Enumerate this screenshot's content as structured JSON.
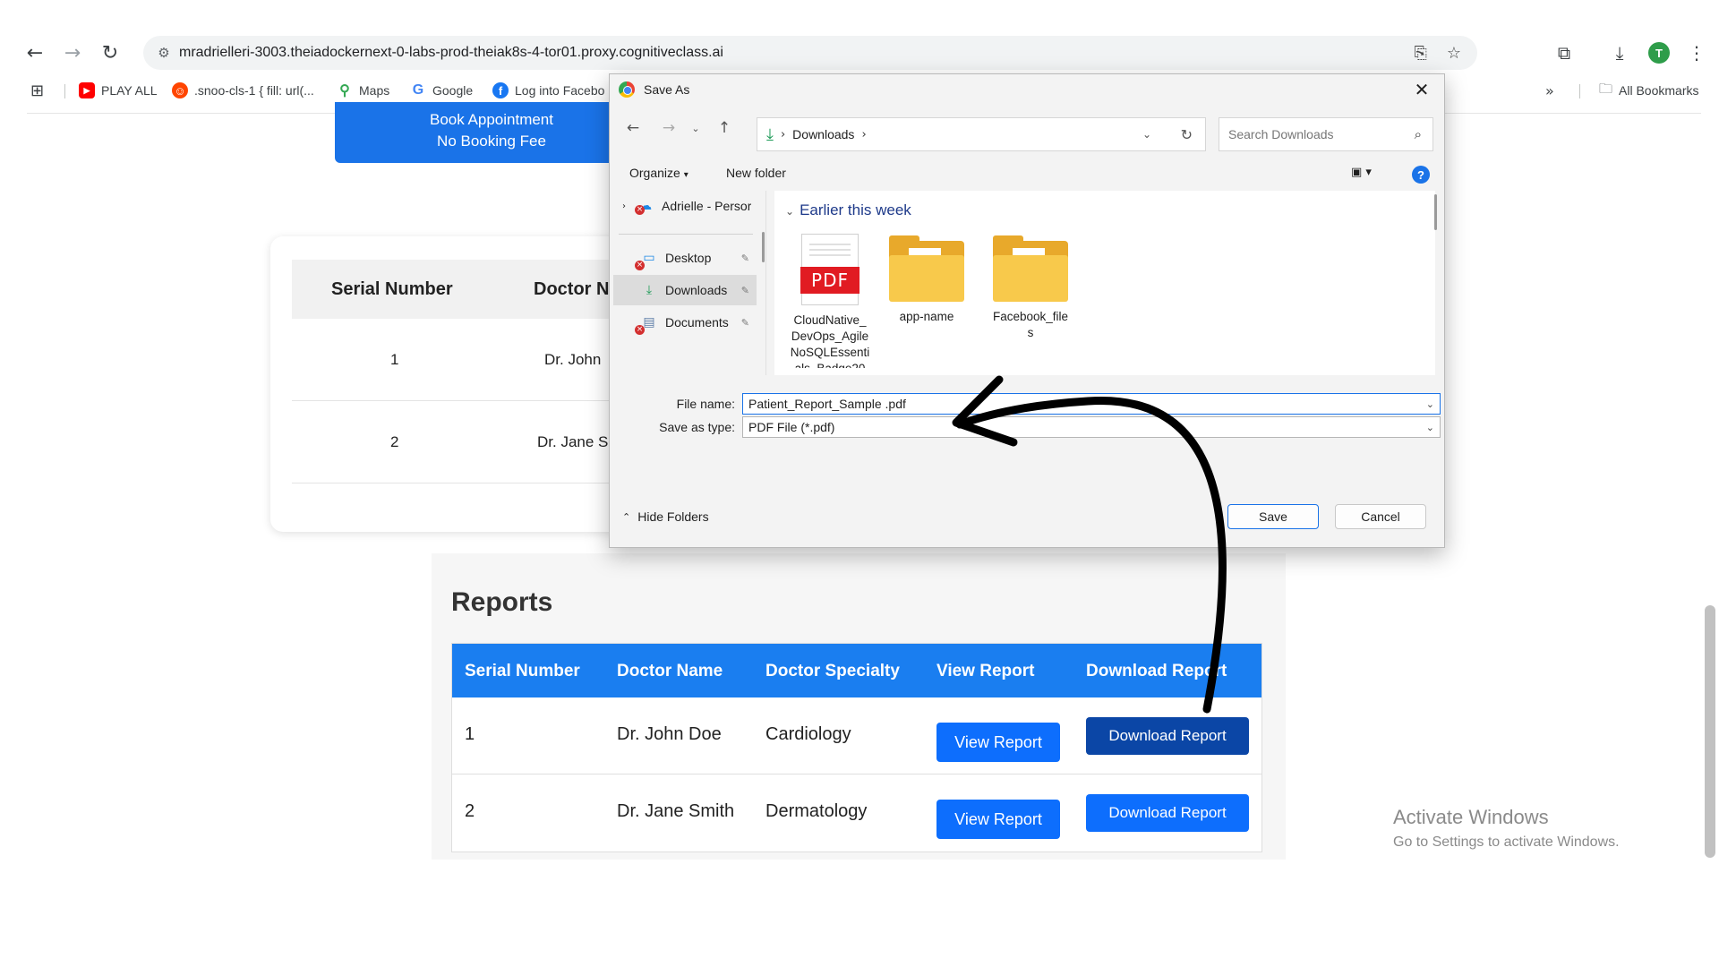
{
  "browser": {
    "url": "mradrielleri-3003.theiadockernext-0-labs-prod-theiak8s-4-tor01.proxy.cognitiveclass.ai",
    "profile_initial": "T",
    "bookmarks": [
      {
        "label": "PLAY ALL",
        "icon": "youtube-icon",
        "color": "#ff0000"
      },
      {
        "label": ".snoo-cls-1 { fill: url(...",
        "icon": "reddit-icon",
        "color": "#ff4500"
      },
      {
        "label": "Maps",
        "icon": "maps-icon",
        "color": "#34a853"
      },
      {
        "label": "Google",
        "icon": "google-icon",
        "color": "#4285f4"
      },
      {
        "label": "Log into Facebo",
        "icon": "facebook-icon",
        "color": "#1877f2"
      }
    ],
    "all_bookmarks_label": "All Bookmarks"
  },
  "page": {
    "book_line1": "Book Appointment",
    "book_line2": "No Booking Fee",
    "appointments": {
      "headers": [
        "Serial Number",
        "Doctor N"
      ],
      "rows": [
        {
          "serial": "1",
          "doctor": "Dr. John"
        },
        {
          "serial": "2",
          "doctor": "Dr. Jane S"
        }
      ]
    },
    "reports": {
      "title": "Reports",
      "headers": [
        "Serial Number",
        "Doctor Name",
        "Doctor Specialty",
        "View Report",
        "Download Report"
      ],
      "rows": [
        {
          "serial": "1",
          "doctor": "Dr. John Doe",
          "specialty": "Cardiology",
          "view": "View Report",
          "download": "Download Report"
        },
        {
          "serial": "2",
          "doctor": "Dr. Jane Smith",
          "specialty": "Dermatology",
          "view": "View Report",
          "download": "Download Report"
        }
      ]
    },
    "activate": {
      "line1": "Activate Windows",
      "line2": "Go to Settings to activate Windows."
    }
  },
  "dialog": {
    "title": "Save As",
    "address_crumb": "Downloads",
    "search_placeholder": "Search Downloads",
    "organize": "Organize",
    "new_folder": "New folder",
    "help": "?",
    "nav": {
      "onedrive": "Adrielle - Persor",
      "items": [
        {
          "label": "Desktop",
          "icon": "desktop-icon"
        },
        {
          "label": "Downloads",
          "icon": "download-icon",
          "selected": true
        },
        {
          "label": "Documents",
          "icon": "documents-icon"
        }
      ]
    },
    "group_header": "Earlier this week",
    "files": [
      {
        "name_lines": [
          "CloudNative_",
          "DevOps_Agile",
          "NoSQLEssenti",
          "als_Badge20"
        ],
        "type": "pdf",
        "badge": "PDF"
      },
      {
        "name_lines": [
          "app-name"
        ],
        "type": "folder"
      },
      {
        "name_lines": [
          "Facebook_file",
          "s"
        ],
        "type": "folder"
      }
    ],
    "file_name_label": "File name:",
    "file_name_value": "Patient_Report_Sample .pdf",
    "save_type_label": "Save as type:",
    "save_type_value": "PDF File (*.pdf)",
    "hide_folders": "Hide Folders",
    "save": "Save",
    "cancel": "Cancel"
  }
}
